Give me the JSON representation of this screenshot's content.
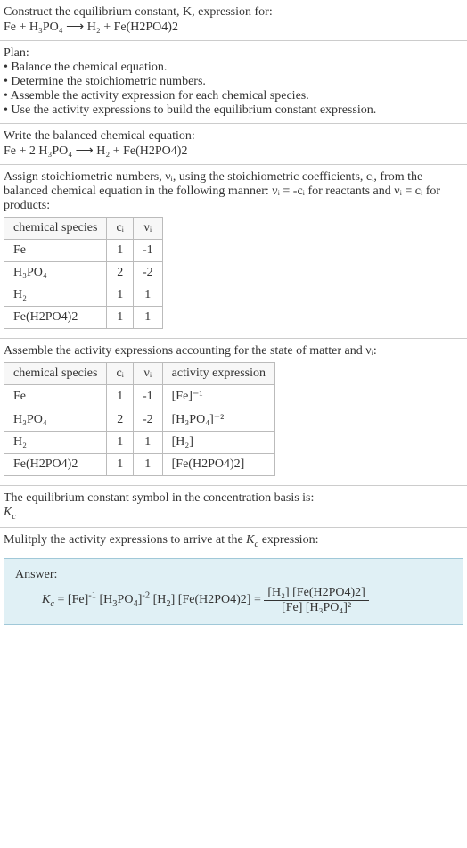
{
  "intro": {
    "line1": "Construct the equilibrium constant, K, expression for:",
    "equation": "Fe + H₃PO₄ ⟶ H₂ + Fe(H2PO4)2"
  },
  "plan": {
    "heading": "Plan:",
    "items": [
      "Balance the chemical equation.",
      "Determine the stoichiometric numbers.",
      "Assemble the activity expression for each chemical species.",
      "Use the activity expressions to build the equilibrium constant expression."
    ]
  },
  "balanced": {
    "heading": "Write the balanced chemical equation:",
    "equation": "Fe + 2 H₃PO₄ ⟶ H₂ + Fe(H2PO4)2"
  },
  "stoich": {
    "heading": "Assign stoichiometric numbers, νᵢ, using the stoichiometric coefficients, cᵢ, from the balanced chemical equation in the following manner: νᵢ = -cᵢ for reactants and νᵢ = cᵢ for products:",
    "headers": [
      "chemical species",
      "cᵢ",
      "νᵢ"
    ],
    "rows": [
      [
        "Fe",
        "1",
        "-1"
      ],
      [
        "H₃PO₄",
        "2",
        "-2"
      ],
      [
        "H₂",
        "1",
        "1"
      ],
      [
        "Fe(H2PO4)2",
        "1",
        "1"
      ]
    ]
  },
  "activity": {
    "heading": "Assemble the activity expressions accounting for the state of matter and νᵢ:",
    "headers": [
      "chemical species",
      "cᵢ",
      "νᵢ",
      "activity expression"
    ],
    "rows": [
      [
        "Fe",
        "1",
        "-1",
        "[Fe]⁻¹"
      ],
      [
        "H₃PO₄",
        "2",
        "-2",
        "[H₃PO₄]⁻²"
      ],
      [
        "H₂",
        "1",
        "1",
        "[H₂]"
      ],
      [
        "Fe(H2PO4)2",
        "1",
        "1",
        "[Fe(H2PO4)2]"
      ]
    ]
  },
  "symbol": {
    "heading": "The equilibrium constant symbol in the concentration basis is:",
    "value": "K_c"
  },
  "multiply": {
    "heading": "Mulitply the activity expressions to arrive at the K_c expression:"
  },
  "answer": {
    "label": "Answer:",
    "lhs": "K_c = [Fe]⁻¹ [H₃PO₄]⁻² [H₂] [Fe(H2PO4)2] = ",
    "num": "[H₂] [Fe(H2PO4)2]",
    "den": "[Fe] [H₃PO₄]²"
  }
}
